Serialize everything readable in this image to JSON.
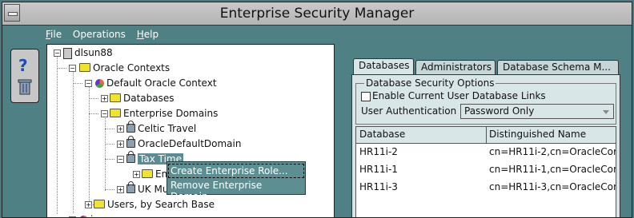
{
  "window": {
    "title": "Enterprise Security Manager"
  },
  "menu": [
    {
      "accel": "F",
      "rest": "ile"
    },
    {
      "accel": "",
      "rest": "Operations"
    },
    {
      "accel": "H",
      "rest": "elp"
    }
  ],
  "toolbar": {
    "help_icon": "?"
  },
  "tree": {
    "root": "dlsun88",
    "oracle_contexts": "Oracle Contexts",
    "default_context": "Default Oracle Context",
    "databases": "Databases",
    "enterprise_domains": "Enterprise Domains",
    "celtic_travel": "Celtic Travel",
    "oracle_default_domain": "OracleDefaultDomain",
    "tax_time": "Tax Time",
    "ente": "Ente",
    "uk_mus": "UK Mus",
    "users_by_search_base": "Users, by Search Base",
    "imc": "imc"
  },
  "context_menu": {
    "create_role": "Create Enterprise Role...",
    "remove_domain": "Remove Enterprise Domain"
  },
  "tabs": [
    "Databases",
    "Administrators",
    "Database Schema M..."
  ],
  "security_options": {
    "group_title": "Database Security Options",
    "enable_links_label": "Enable Current User Database Links",
    "auth_label": "User Authentication",
    "auth_value": "Password Only"
  },
  "db_table": {
    "headers": [
      "Database",
      "Distinguished Name"
    ],
    "rows": [
      [
        "HR11i-2",
        "cn=HR11i-2,cn=OracleCon"
      ],
      [
        "HR11i-1",
        "cn=HR11i-1,cn=OracleCon"
      ],
      [
        "HR11i-3",
        "cn=HR11i-3,cn=OracleCon"
      ]
    ]
  }
}
